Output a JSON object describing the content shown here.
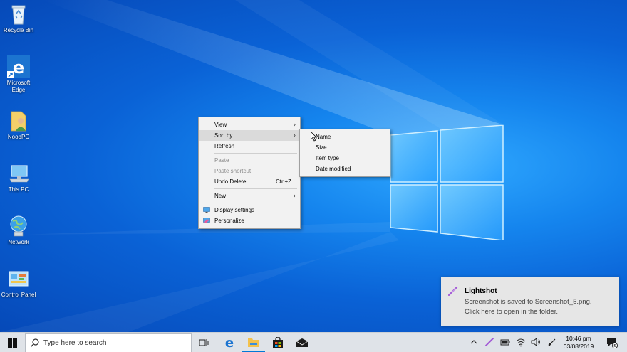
{
  "desktop_icons": [
    {
      "name": "recycle-bin",
      "label": "Recycle Bin"
    },
    {
      "name": "microsoft-edge",
      "label": "Microsoft Edge"
    },
    {
      "name": "user-folder",
      "label": "NoobPC"
    },
    {
      "name": "this-pc",
      "label": "This PC"
    },
    {
      "name": "network",
      "label": "Network"
    },
    {
      "name": "control-panel",
      "label": "Control Panel"
    }
  ],
  "context_menu": {
    "view": "View",
    "sort_by": "Sort by",
    "refresh": "Refresh",
    "paste": "Paste",
    "paste_shortcut": "Paste shortcut",
    "undo_delete": "Undo Delete",
    "undo_shortcut": "Ctrl+Z",
    "new": "New",
    "display_settings": "Display settings",
    "personalize": "Personalize"
  },
  "sort_submenu": {
    "name": "Name",
    "size": "Size",
    "item_type": "Item type",
    "date_modified": "Date modified"
  },
  "toast": {
    "title": "Lightshot",
    "line1": "Screenshot is saved to Screenshot_5.png.",
    "line2": "Click here to open in the folder."
  },
  "taskbar": {
    "search_placeholder": "Type here to search",
    "time": "10:46 pm",
    "date": "03/08/2019",
    "notification_count": "5"
  },
  "colors": {
    "accent": "#0078d7",
    "lightshot": "#a35bd6"
  }
}
